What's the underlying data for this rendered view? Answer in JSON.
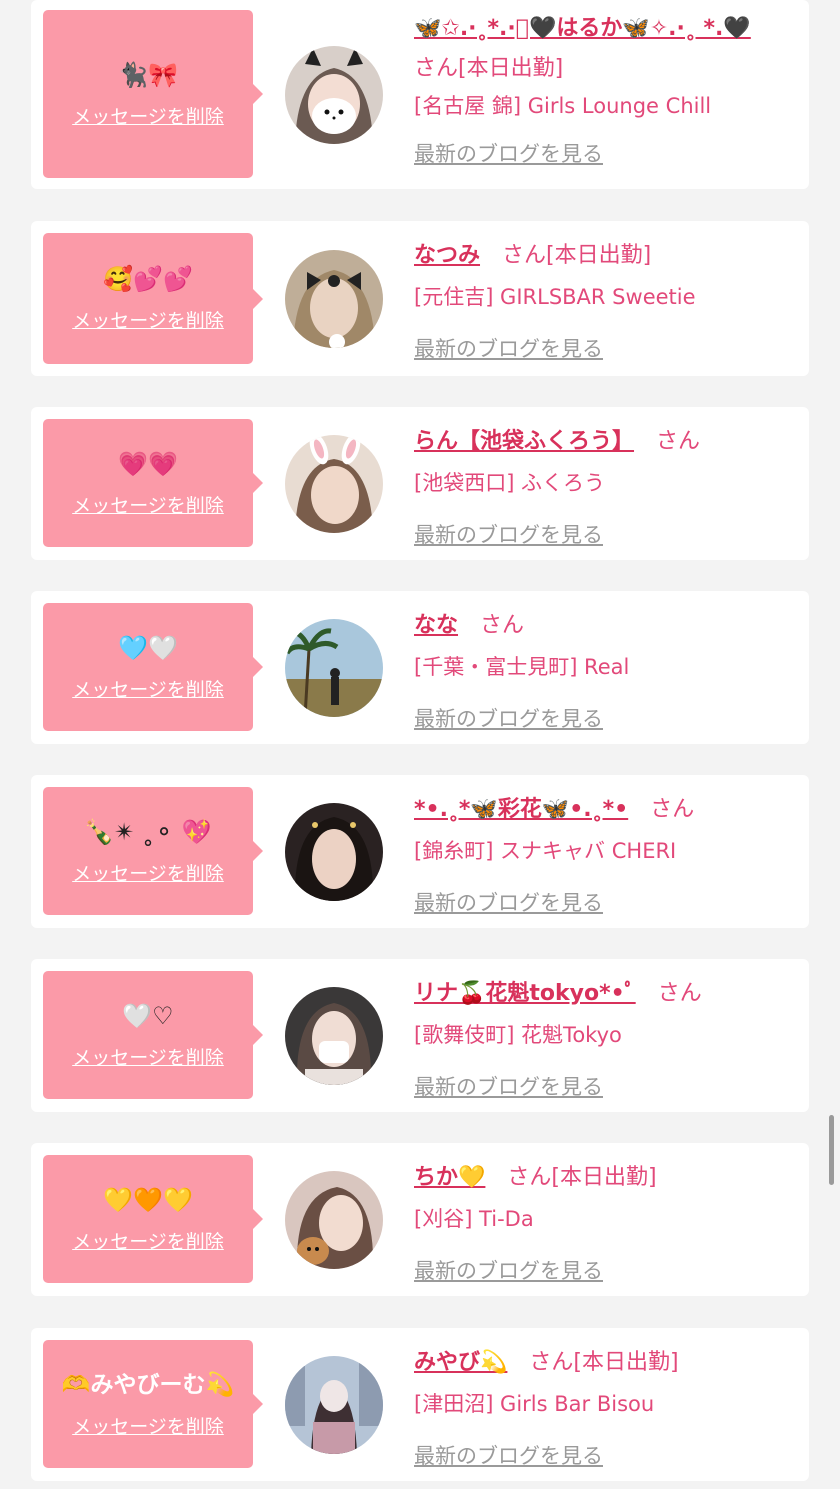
{
  "common": {
    "delete_label": "メッセージを削除",
    "blog_label": "最新のブログを見る",
    "honorific": "さん"
  },
  "colors": {
    "background": "#f3f3f3",
    "card": "#ffffff",
    "bubble": "#fb9aa8",
    "name": "#d8315b",
    "text_pink": "#e2497a",
    "link_gray": "#9a9a9a"
  },
  "items": [
    {
      "message": "🐈‍⬛🎀",
      "name": "🦋✩.·˳*.·ﾟ🖤はるか🦋✧.·˳ *.🖤",
      "status": "[本日出勤]",
      "shop": "[名古屋 錦] Girls Lounge Chill",
      "avatar_icon": "cat-filter-avatar"
    },
    {
      "message": "🥰💕💕",
      "name": "なつみ",
      "status": "[本日出勤]",
      "shop": "[元住吉] GIRLSBAR Sweetie",
      "avatar_icon": "bow-filter-avatar"
    },
    {
      "message": "💗💗",
      "name": "らん【池袋ふくろう】",
      "status": "",
      "shop": "[池袋西口] ふくろう",
      "avatar_icon": "bunny-filter-avatar"
    },
    {
      "message": "🩵🤍",
      "name": "なな",
      "status": "",
      "shop": "[千葉・富士見町] Real",
      "avatar_icon": "palm-tree-avatar"
    },
    {
      "message": "🍾✴︎ ˳⚬ 💖",
      "name": "*•.˳*🦋彩花🦋•.˳*•",
      "status": "",
      "shop": "[錦糸町] スナキャバ CHERI",
      "avatar_icon": "portrait-avatar"
    },
    {
      "message": "🤍♡",
      "name": "リナ🍒花魁tokyo*•ﾟ",
      "status": "",
      "shop": "[歌舞伎町] 花魁Tokyo",
      "avatar_icon": "mask-portrait-avatar"
    },
    {
      "message": "💛🧡💛",
      "name": "ちか💛",
      "status": "[本日出勤]",
      "shop": "[刈谷] Ti-Da",
      "avatar_icon": "dog-portrait-avatar"
    },
    {
      "message": "🫶みやびーむ💫",
      "name": "みやび💫",
      "status": "[本日出勤]",
      "shop": "[津田沼] Girls Bar Bisou",
      "avatar_icon": "city-portrait-avatar"
    }
  ]
}
